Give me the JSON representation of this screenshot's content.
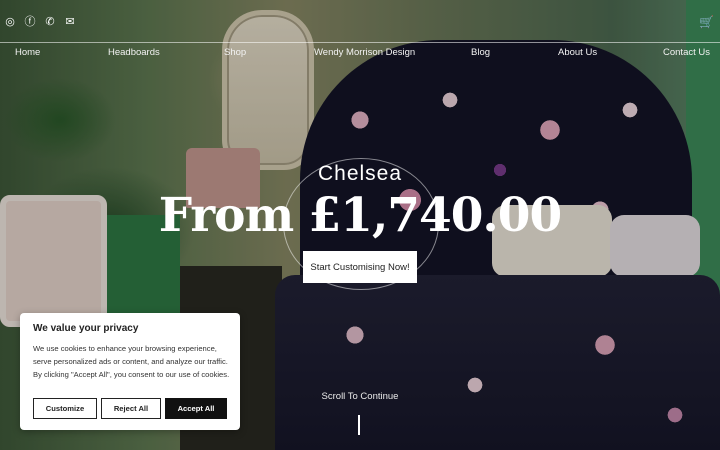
{
  "social": [
    {
      "icon": "instagram-icon",
      "glyph": "◎"
    },
    {
      "icon": "facebook-icon",
      "glyph": "ⓕ"
    },
    {
      "icon": "phone-icon",
      "glyph": "✆"
    },
    {
      "icon": "email-icon",
      "glyph": "✉"
    }
  ],
  "cart": {
    "icon": "cart-icon",
    "glyph": "🛒"
  },
  "nav": [
    {
      "label": "Home"
    },
    {
      "label": "Headboards"
    },
    {
      "label": "Shop"
    },
    {
      "label": "Wendy Morrison Design"
    },
    {
      "label": "Blog"
    },
    {
      "label": "About Us"
    },
    {
      "label": "Contact Us"
    }
  ],
  "hero": {
    "subtitle": "Chelsea",
    "price": "From £1,740.00",
    "cta": "Start Customising Now!",
    "scroll": "Scroll To Continue"
  },
  "cookie": {
    "title": "We value your privacy",
    "body": "We use cookies to enhance your browsing experience, serve personalized ads or content, and analyze our traffic. By clicking \"Accept All\", you consent to our use of cookies.",
    "customize": "Customize",
    "reject": "Reject All",
    "accept": "Accept All"
  }
}
